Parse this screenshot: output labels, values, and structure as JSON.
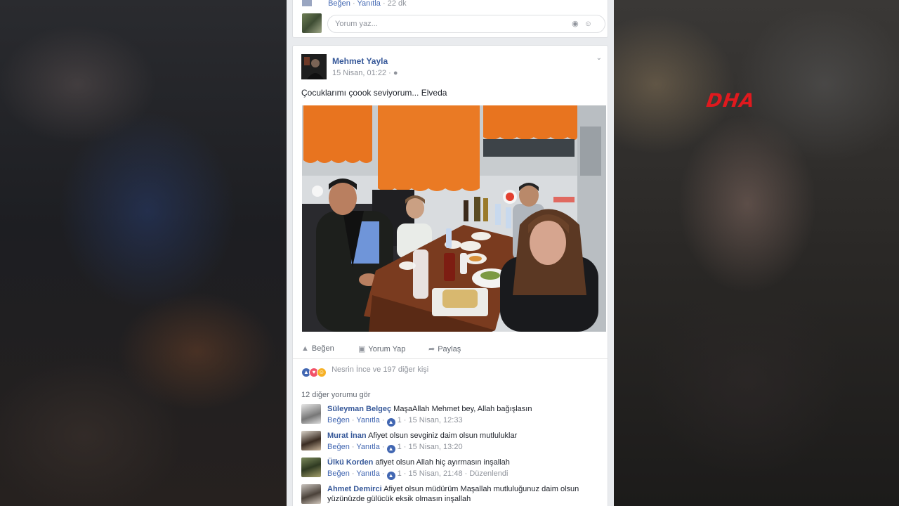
{
  "overlay": {
    "logo_text": "DHA",
    "logo_color": "#e0191e"
  },
  "prev_post": {
    "like_label": "Beğen",
    "reply_label": "Yanıtla",
    "time": "22 dk",
    "comment_placeholder": "Yorum yaz..."
  },
  "post": {
    "author": "Mehmet Yayla",
    "date": "15 Nisan, 01:22",
    "privacy_icon": "globe-icon",
    "text": "Çocuklarımı çoook seviyorum... Elveda",
    "actions": {
      "like": "Beğen",
      "comment": "Yorum Yap",
      "share": "Paylaş"
    },
    "reactions_text": "Nesrin İnce ve 197 diğer kişi",
    "more_comments": "12 diğer yorumu gör"
  },
  "comments": [
    {
      "name": "Süleyman Belgeç",
      "text": "MaşaAllah Mehmet bey, Allah bağışlasın",
      "like": "Beğen",
      "reply": "Yanıtla",
      "likes": "1",
      "time": "15 Nisan, 12:33",
      "extra": ""
    },
    {
      "name": "Murat İnan",
      "text": "Afiyet olsun sevginiz daim olsun mutluluklar",
      "like": "Beğen",
      "reply": "Yanıtla",
      "likes": "1",
      "time": "15 Nisan, 13:20",
      "extra": ""
    },
    {
      "name": "Ülkü Korden",
      "text": "afiyet olsun Allah hiç ayırmasın inşallah",
      "like": "Beğen",
      "reply": "Yanıtla",
      "likes": "1",
      "time": "15 Nisan, 21:48",
      "extra": "Düzenlendi"
    },
    {
      "name": "Ahmet Demirci",
      "text": "Afiyet olsun müdürüm Maşallah mutluluğunuz daim olsun yüzünüzde gülücük eksik olmasın inşallah",
      "like": "",
      "reply": "",
      "likes": "",
      "time": "",
      "extra": ""
    }
  ],
  "colors": {
    "link": "#365899",
    "accent": "#4267b2",
    "feed_bg": "#e9ebee"
  }
}
